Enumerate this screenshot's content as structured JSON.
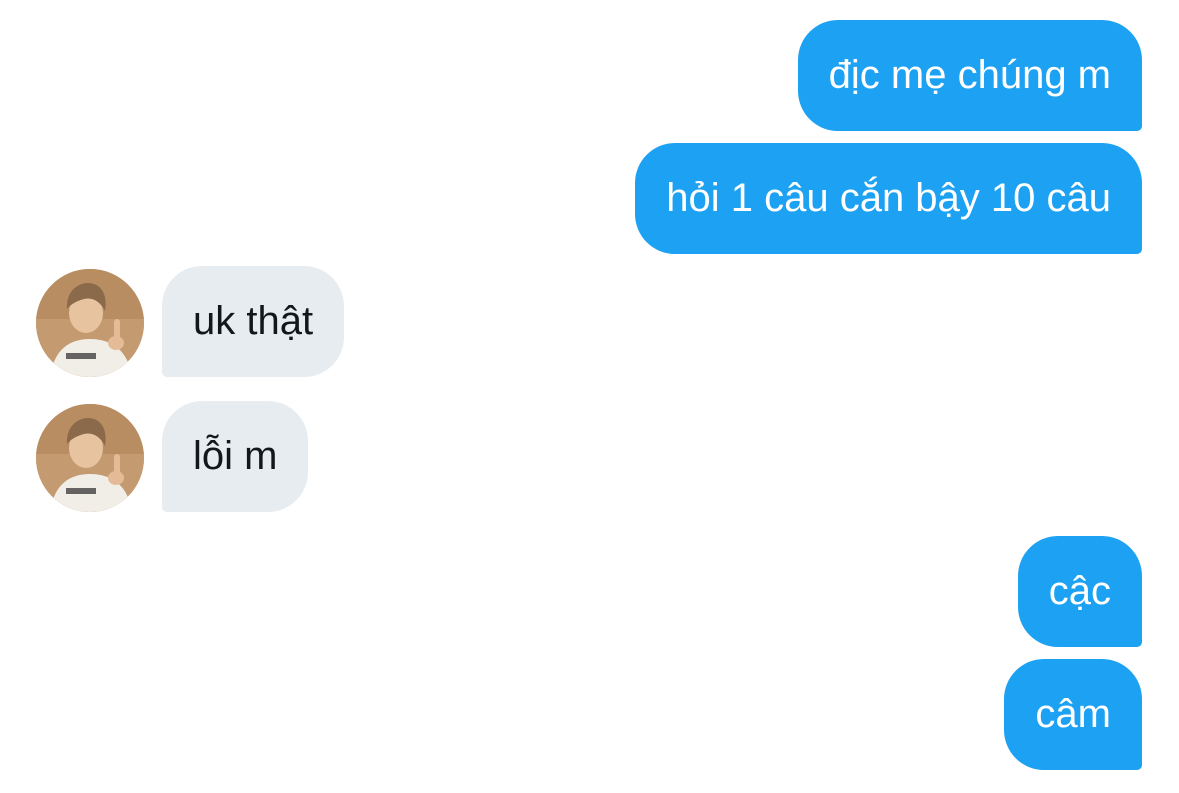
{
  "conversation": {
    "messages": [
      {
        "sender": "me",
        "text": "địc mẹ chúng m"
      },
      {
        "sender": "me",
        "text": "hỏi 1 câu cắn bậy 10 câu"
      },
      {
        "sender": "other",
        "text": "uk thật",
        "avatar": "user-avatar-photo"
      },
      {
        "sender": "other",
        "text": "lỗi m",
        "avatar": "user-avatar-photo"
      },
      {
        "sender": "me",
        "text": "cậc"
      },
      {
        "sender": "me",
        "text": "câm"
      }
    ]
  },
  "colors": {
    "sent_bubble": "#1da1f2",
    "sent_text": "#ffffff",
    "received_bubble": "#e6ecf0",
    "received_text": "#14171a",
    "background": "#ffffff"
  }
}
